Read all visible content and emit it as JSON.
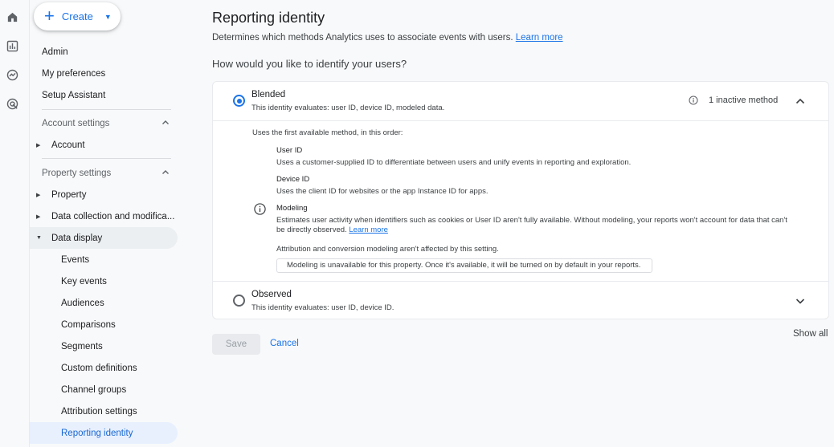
{
  "rail": {
    "icons": [
      "home-icon",
      "reports-icon",
      "explore-icon",
      "advertising-icon"
    ]
  },
  "nav": {
    "create_label": "Create",
    "admin": "Admin",
    "my_preferences": "My preferences",
    "setup_assistant": "Setup Assistant",
    "account_settings": "Account settings",
    "account": "Account",
    "property_settings": "Property settings",
    "property": "Property",
    "data_collection": "Data collection and modifica...",
    "data_display": "Data display",
    "events": "Events",
    "key_events": "Key events",
    "audiences": "Audiences",
    "comparisons": "Comparisons",
    "segments": "Segments",
    "custom_definitions": "Custom definitions",
    "channel_groups": "Channel groups",
    "attribution_settings": "Attribution settings",
    "reporting_identity": "Reporting identity"
  },
  "main": {
    "title": "Reporting identity",
    "description": "Determines which methods Analytics uses to associate events with users.",
    "learn_more": "Learn more",
    "question": "How would you like to identify your users?",
    "blended": {
      "title": "Blended",
      "subtitle": "This identity evaluates: user ID, device ID, modeled data.",
      "inactive": "1 inactive method",
      "order_text": "Uses the first available method, in this order:",
      "user_id_title": "User ID",
      "user_id_desc": "Uses a customer-supplied ID to differentiate between users and unify events in reporting and exploration.",
      "device_id_title": "Device ID",
      "device_id_desc": "Uses the client ID for websites or the app Instance ID for apps.",
      "modeling_title": "Modeling",
      "modeling_desc_1": "Estimates user activity when identifiers such as cookies or User ID aren't fully available. Without modeling, your reports won't account for data that can't",
      "modeling_desc_2": "be directly observed.",
      "modeling_learn_more": "Learn more",
      "attribution_note": "Attribution and conversion modeling aren't affected by this setting.",
      "notice": "Modeling is unavailable for this property. Once it's available, it will be turned on by default in your reports."
    },
    "observed": {
      "title": "Observed",
      "subtitle": "This identity evaluates: user ID, device ID."
    },
    "show_all": "Show all",
    "save": "Save",
    "cancel": "Cancel"
  },
  "colors": {
    "accent": "#1a73e8",
    "active_bg": "#e8f0fe"
  }
}
